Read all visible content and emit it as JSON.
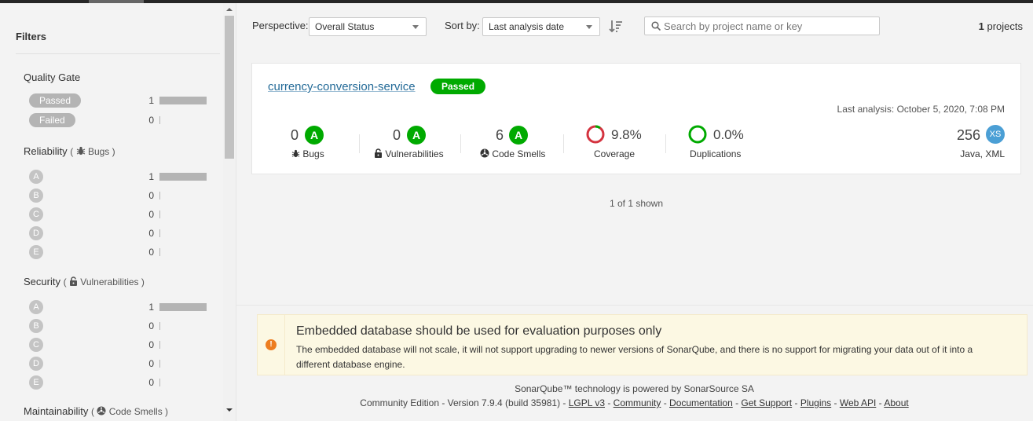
{
  "sidebar": {
    "title": "Filters",
    "quality_gate": {
      "title": "Quality Gate",
      "items": [
        {
          "label": "Passed",
          "count": "1",
          "fill": 1.0
        },
        {
          "label": "Failed",
          "count": "0",
          "fill": 0
        }
      ]
    },
    "reliability": {
      "title": "Reliability",
      "sub": "Bugs",
      "items": [
        {
          "label": "A",
          "count": "1",
          "fill": 1.0
        },
        {
          "label": "B",
          "count": "0",
          "fill": 0
        },
        {
          "label": "C",
          "count": "0",
          "fill": 0
        },
        {
          "label": "D",
          "count": "0",
          "fill": 0
        },
        {
          "label": "E",
          "count": "0",
          "fill": 0
        }
      ]
    },
    "security": {
      "title": "Security",
      "sub": "Vulnerabilities",
      "items": [
        {
          "label": "A",
          "count": "1",
          "fill": 1.0
        },
        {
          "label": "B",
          "count": "0",
          "fill": 0
        },
        {
          "label": "C",
          "count": "0",
          "fill": 0
        },
        {
          "label": "D",
          "count": "0",
          "fill": 0
        },
        {
          "label": "E",
          "count": "0",
          "fill": 0
        }
      ]
    },
    "maintainability": {
      "title": "Maintainability",
      "sub": "Code Smells"
    }
  },
  "toolbar": {
    "perspective_label": "Perspective:",
    "perspective_value": "Overall Status",
    "sort_label": "Sort by:",
    "sort_value": "Last analysis date",
    "search_placeholder": "Search by project name or key",
    "count_number": "1",
    "count_suffix": " projects"
  },
  "project": {
    "name": "currency-conversion-service",
    "quality_gate": "Passed",
    "last_analysis": "Last analysis: October 5, 2020, 7:08 PM",
    "bugs": {
      "value": "0",
      "rating": "A",
      "label": "Bugs"
    },
    "vulnerabilities": {
      "value": "0",
      "rating": "A",
      "label": "Vulnerabilities"
    },
    "code_smells": {
      "value": "6",
      "rating": "A",
      "label": "Code Smells"
    },
    "coverage": {
      "value": "9.8%",
      "label": "Coverage",
      "fraction": 0.098
    },
    "duplications": {
      "value": "0.0%",
      "label": "Duplications",
      "fraction": 0.0
    },
    "size": {
      "value": "256",
      "badge": "XS",
      "languages": "Java, XML"
    }
  },
  "shown": "1 of 1 shown",
  "alert": {
    "title": "Embedded database should be used for evaluation purposes only",
    "text": "The embedded database will not scale, it will not support upgrading to newer versions of SonarQube, and there is no support for migrating your data out of it into a different database engine."
  },
  "footer": {
    "powered": "SonarQube™ technology is powered by SonarSource SA",
    "edition": "Community Edition - Version 7.9.4 (build 35981) - ",
    "links": [
      "LGPL v3",
      "Community",
      "Documentation",
      "Get Support",
      "Plugins",
      "Web API",
      "About"
    ]
  },
  "colors": {
    "rating_a": "#00aa00",
    "coverage_red": "#d4333f",
    "link_blue": "#236a97",
    "size_badge": "#4b9fd5",
    "warning_orange": "#ed7d20"
  }
}
